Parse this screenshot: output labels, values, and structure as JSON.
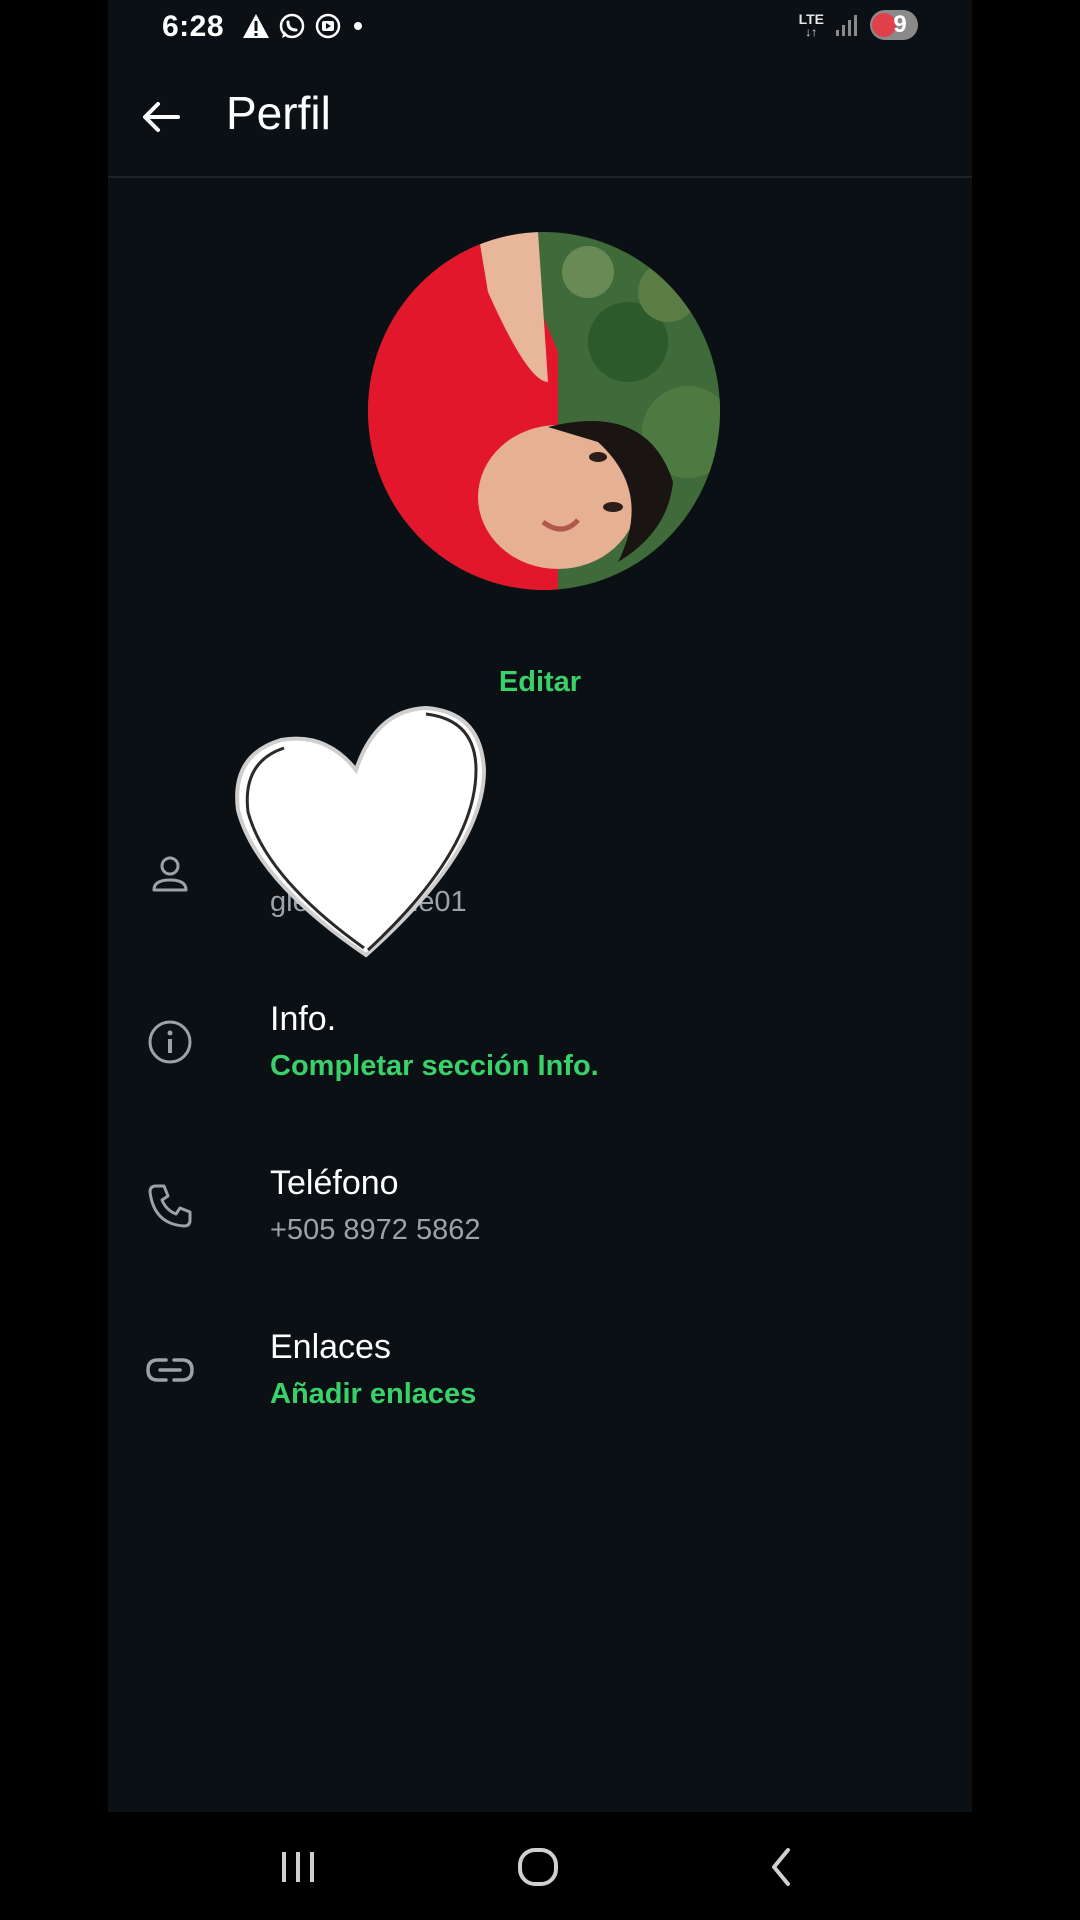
{
  "status_bar": {
    "time": "6:28",
    "icons_left": [
      "alert-icon",
      "whatsapp-icon",
      "media-icon",
      "dot-icon"
    ],
    "network": "LTE",
    "battery_level": "9"
  },
  "header": {
    "title": "Perfil"
  },
  "profile": {
    "edit_label": "Editar"
  },
  "rows": {
    "name": {
      "value": "gle01",
      "partial_visible_prefix": "gle"
    },
    "info": {
      "title": "Info.",
      "subtitle": "Completar sección Info."
    },
    "phone": {
      "title": "Teléfono",
      "subtitle": "+505 8972 5862"
    },
    "links": {
      "title": "Enlaces",
      "subtitle": "Añadir enlaces"
    }
  },
  "colors": {
    "accent": "#3ad06a",
    "background": "#0b1014",
    "text": "#ffffff",
    "muted": "#9aa3a8"
  }
}
